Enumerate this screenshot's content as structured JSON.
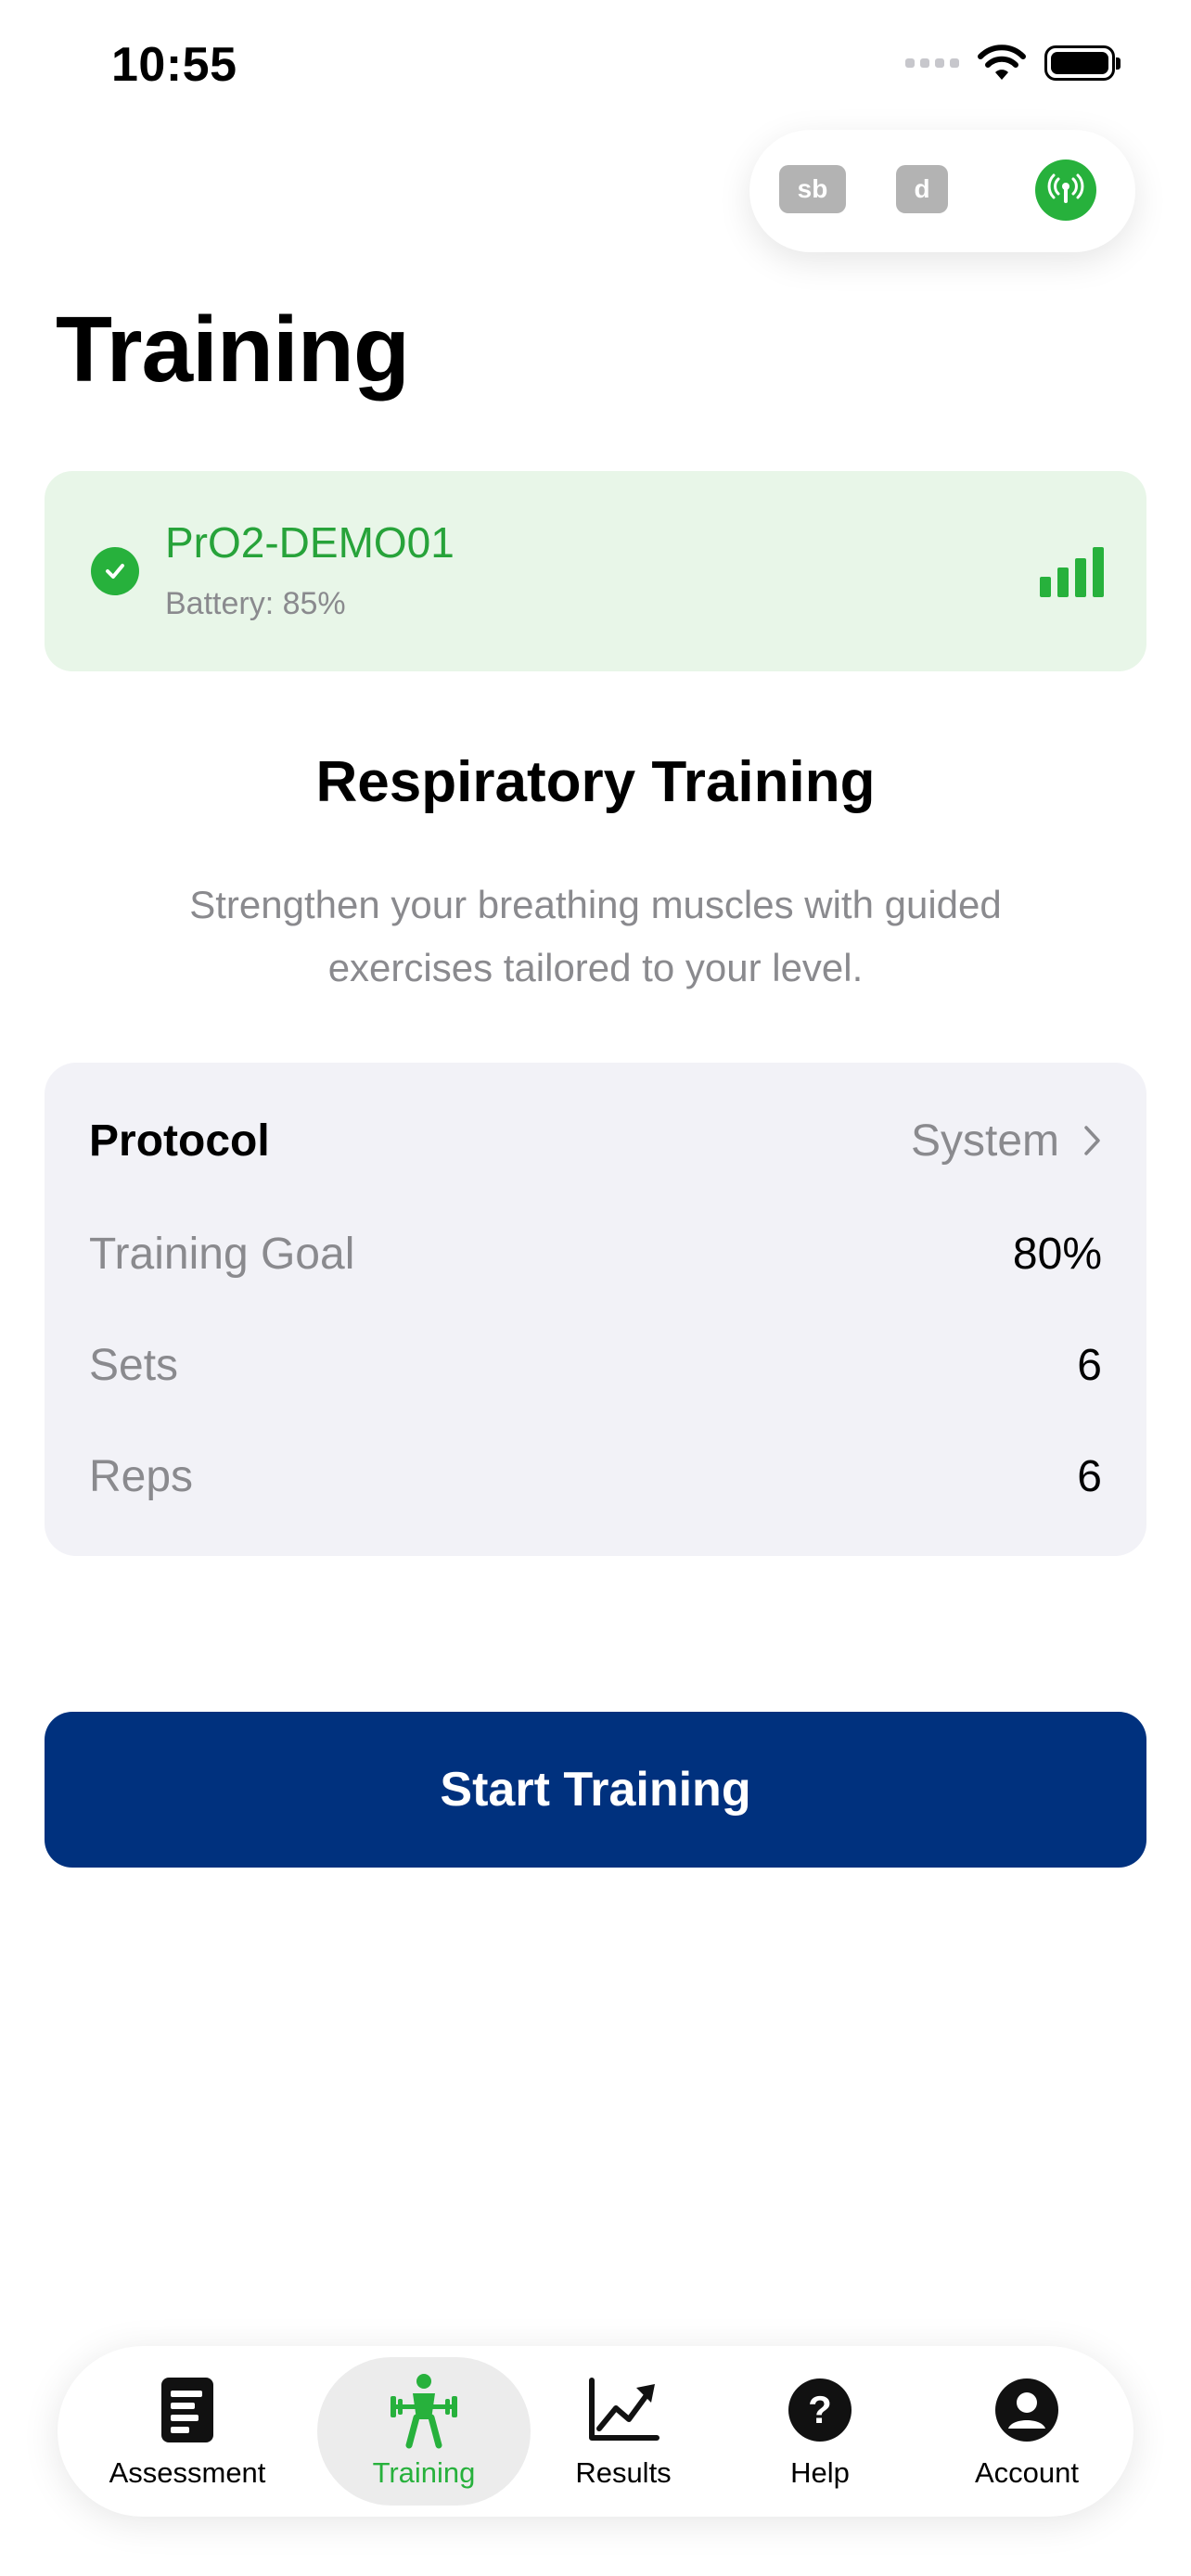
{
  "status_bar": {
    "time": "10:55"
  },
  "debug_pill": {
    "chip_sb": "sb",
    "chip_d": "d"
  },
  "page": {
    "title": "Training"
  },
  "device": {
    "name": "PrO2-DEMO01",
    "battery": "Battery: 85%"
  },
  "intro": {
    "title": "Respiratory Training",
    "description": "Strengthen your breathing muscles with guided exercises tailored to your level."
  },
  "settings": {
    "protocol_label": "Protocol",
    "protocol_value": "System",
    "rows": [
      {
        "label": "Training Goal",
        "value": "80%"
      },
      {
        "label": "Sets",
        "value": "6"
      },
      {
        "label": "Reps",
        "value": "6"
      }
    ]
  },
  "start_button": {
    "label": "Start Training"
  },
  "tabs": [
    {
      "label": "Assessment",
      "icon": "assessment-icon"
    },
    {
      "label": "Training",
      "icon": "weightlifter-icon",
      "active": true
    },
    {
      "label": "Results",
      "icon": "chart-trend-icon"
    },
    {
      "label": "Help",
      "icon": "help-icon"
    },
    {
      "label": "Account",
      "icon": "account-icon"
    }
  ],
  "colors": {
    "accent_green": "#27b13c",
    "device_card_bg": "#e8f6e8",
    "primary_navy": "#00317e",
    "card_gray": "#f2f2f7",
    "muted_text": "#8a8a8e"
  }
}
